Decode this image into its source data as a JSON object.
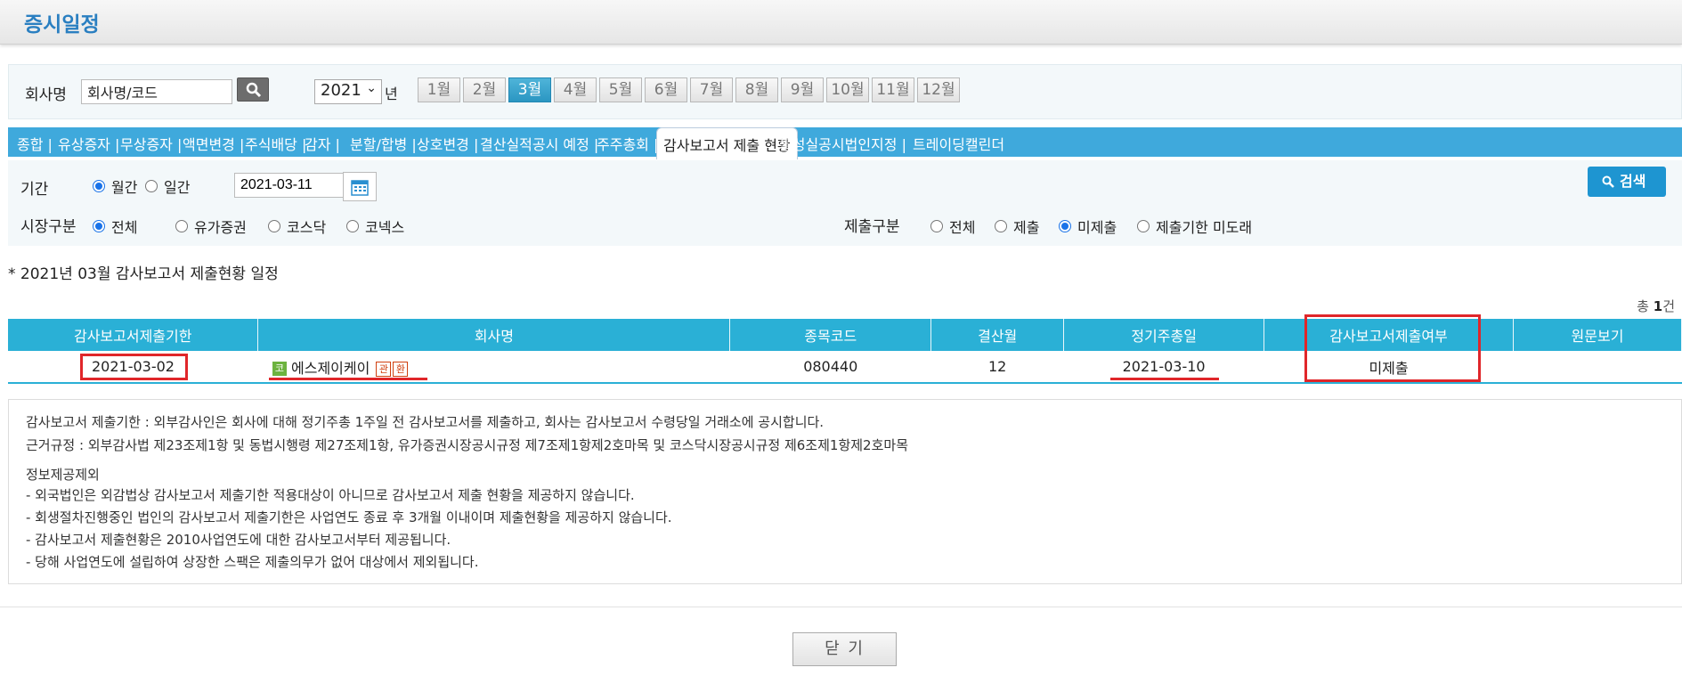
{
  "header": {
    "title": "증시일정"
  },
  "search": {
    "company_label": "회사명",
    "company_placeholder": "회사명/코드",
    "year": "2021",
    "year_unit": "년",
    "months": [
      "1월",
      "2월",
      "3월",
      "4월",
      "5월",
      "6월",
      "7월",
      "8월",
      "9월",
      "10월",
      "11월",
      "12월"
    ],
    "active_month": "3월"
  },
  "tabs": [
    {
      "label": "종합 |"
    },
    {
      "label": "유상증자 |"
    },
    {
      "label": "무상증자 |"
    },
    {
      "label": "액면변경 |"
    },
    {
      "label": "주식배당 |"
    },
    {
      "label": "감자 |"
    },
    {
      "label": "분할/합병 |"
    },
    {
      "label": "상호변경 |"
    },
    {
      "label": "결산실적공시 예정 |"
    },
    {
      "label": "주주총회 |"
    },
    {
      "label": "감사보고서 제출 현황"
    },
    {
      "label": "불성실공시법인지정 |"
    },
    {
      "label": "트레이딩캘린더"
    }
  ],
  "filters": {
    "period_label": "기간",
    "period_options": [
      "월간",
      "일간"
    ],
    "date_value": "2021-03-11",
    "market_label": "시장구분",
    "market_options": [
      "전체",
      "유가증권",
      "코스닥",
      "코넥스"
    ],
    "submit_label": "제출구분",
    "submit_options": [
      "전체",
      "제출",
      "미제출",
      "제출기한 미도래"
    ],
    "search_button": "검색"
  },
  "subtitle": "* 2021년 03월 감사보고서 제출현황 일정",
  "total": {
    "prefix": "총 ",
    "count": "1",
    "suffix": "건"
  },
  "table": {
    "headers": [
      "감사보고서제출기한",
      "회사명",
      "종목코드",
      "결산월",
      "정기주총일",
      "감사보고서제출여부",
      "원문보기"
    ],
    "rows": [
      {
        "deadline": "2021-03-02",
        "market_badge": "코",
        "company": "에스제이케이",
        "badge1": "관",
        "badge2": "환",
        "code": "080440",
        "fiscal_month": "12",
        "agm_date": "2021-03-10",
        "status": "미제출",
        "original": ""
      }
    ]
  },
  "notes": [
    "감사보고서 제출기한 : 외부감사인은 회사에 대해 정기주총 1주일 전 감사보고서를 제출하고, 회사는 감사보고서 수령당일 거래소에 공시합니다.",
    "근거규정 : 외부감사법 제23조제1항 및 동법시행령 제27조제1항, 유가증권시장공시규정 제7조제1항제2호마목 및 코스닥시장공시규정 제6조제1항제2호마목",
    "정보제공제외",
    "- 외국법인은 외감법상 감사보고서 제출기한 적용대상이 아니므로 감사보고서 제출 현황을 제공하지 않습니다.",
    "- 회생절차진행중인 법인의 감사보고서 제출기한은 사업연도 종료 후 3개월 이내이며 제출현황을 제공하지 않습니다.",
    "- 감사보고서 제출현황은 2010사업연도에 대한 감사보고서부터 제공됩니다.",
    "- 당해 사업연도에 설립하여 상장한 스팩은 제출의무가 없어 대상에서 제외됩니다."
  ],
  "close_button": "닫 기",
  "colors": {
    "accent": "#2ab0d6",
    "tab_bar": "#3fa9dc",
    "highlight": "#e0262a"
  }
}
